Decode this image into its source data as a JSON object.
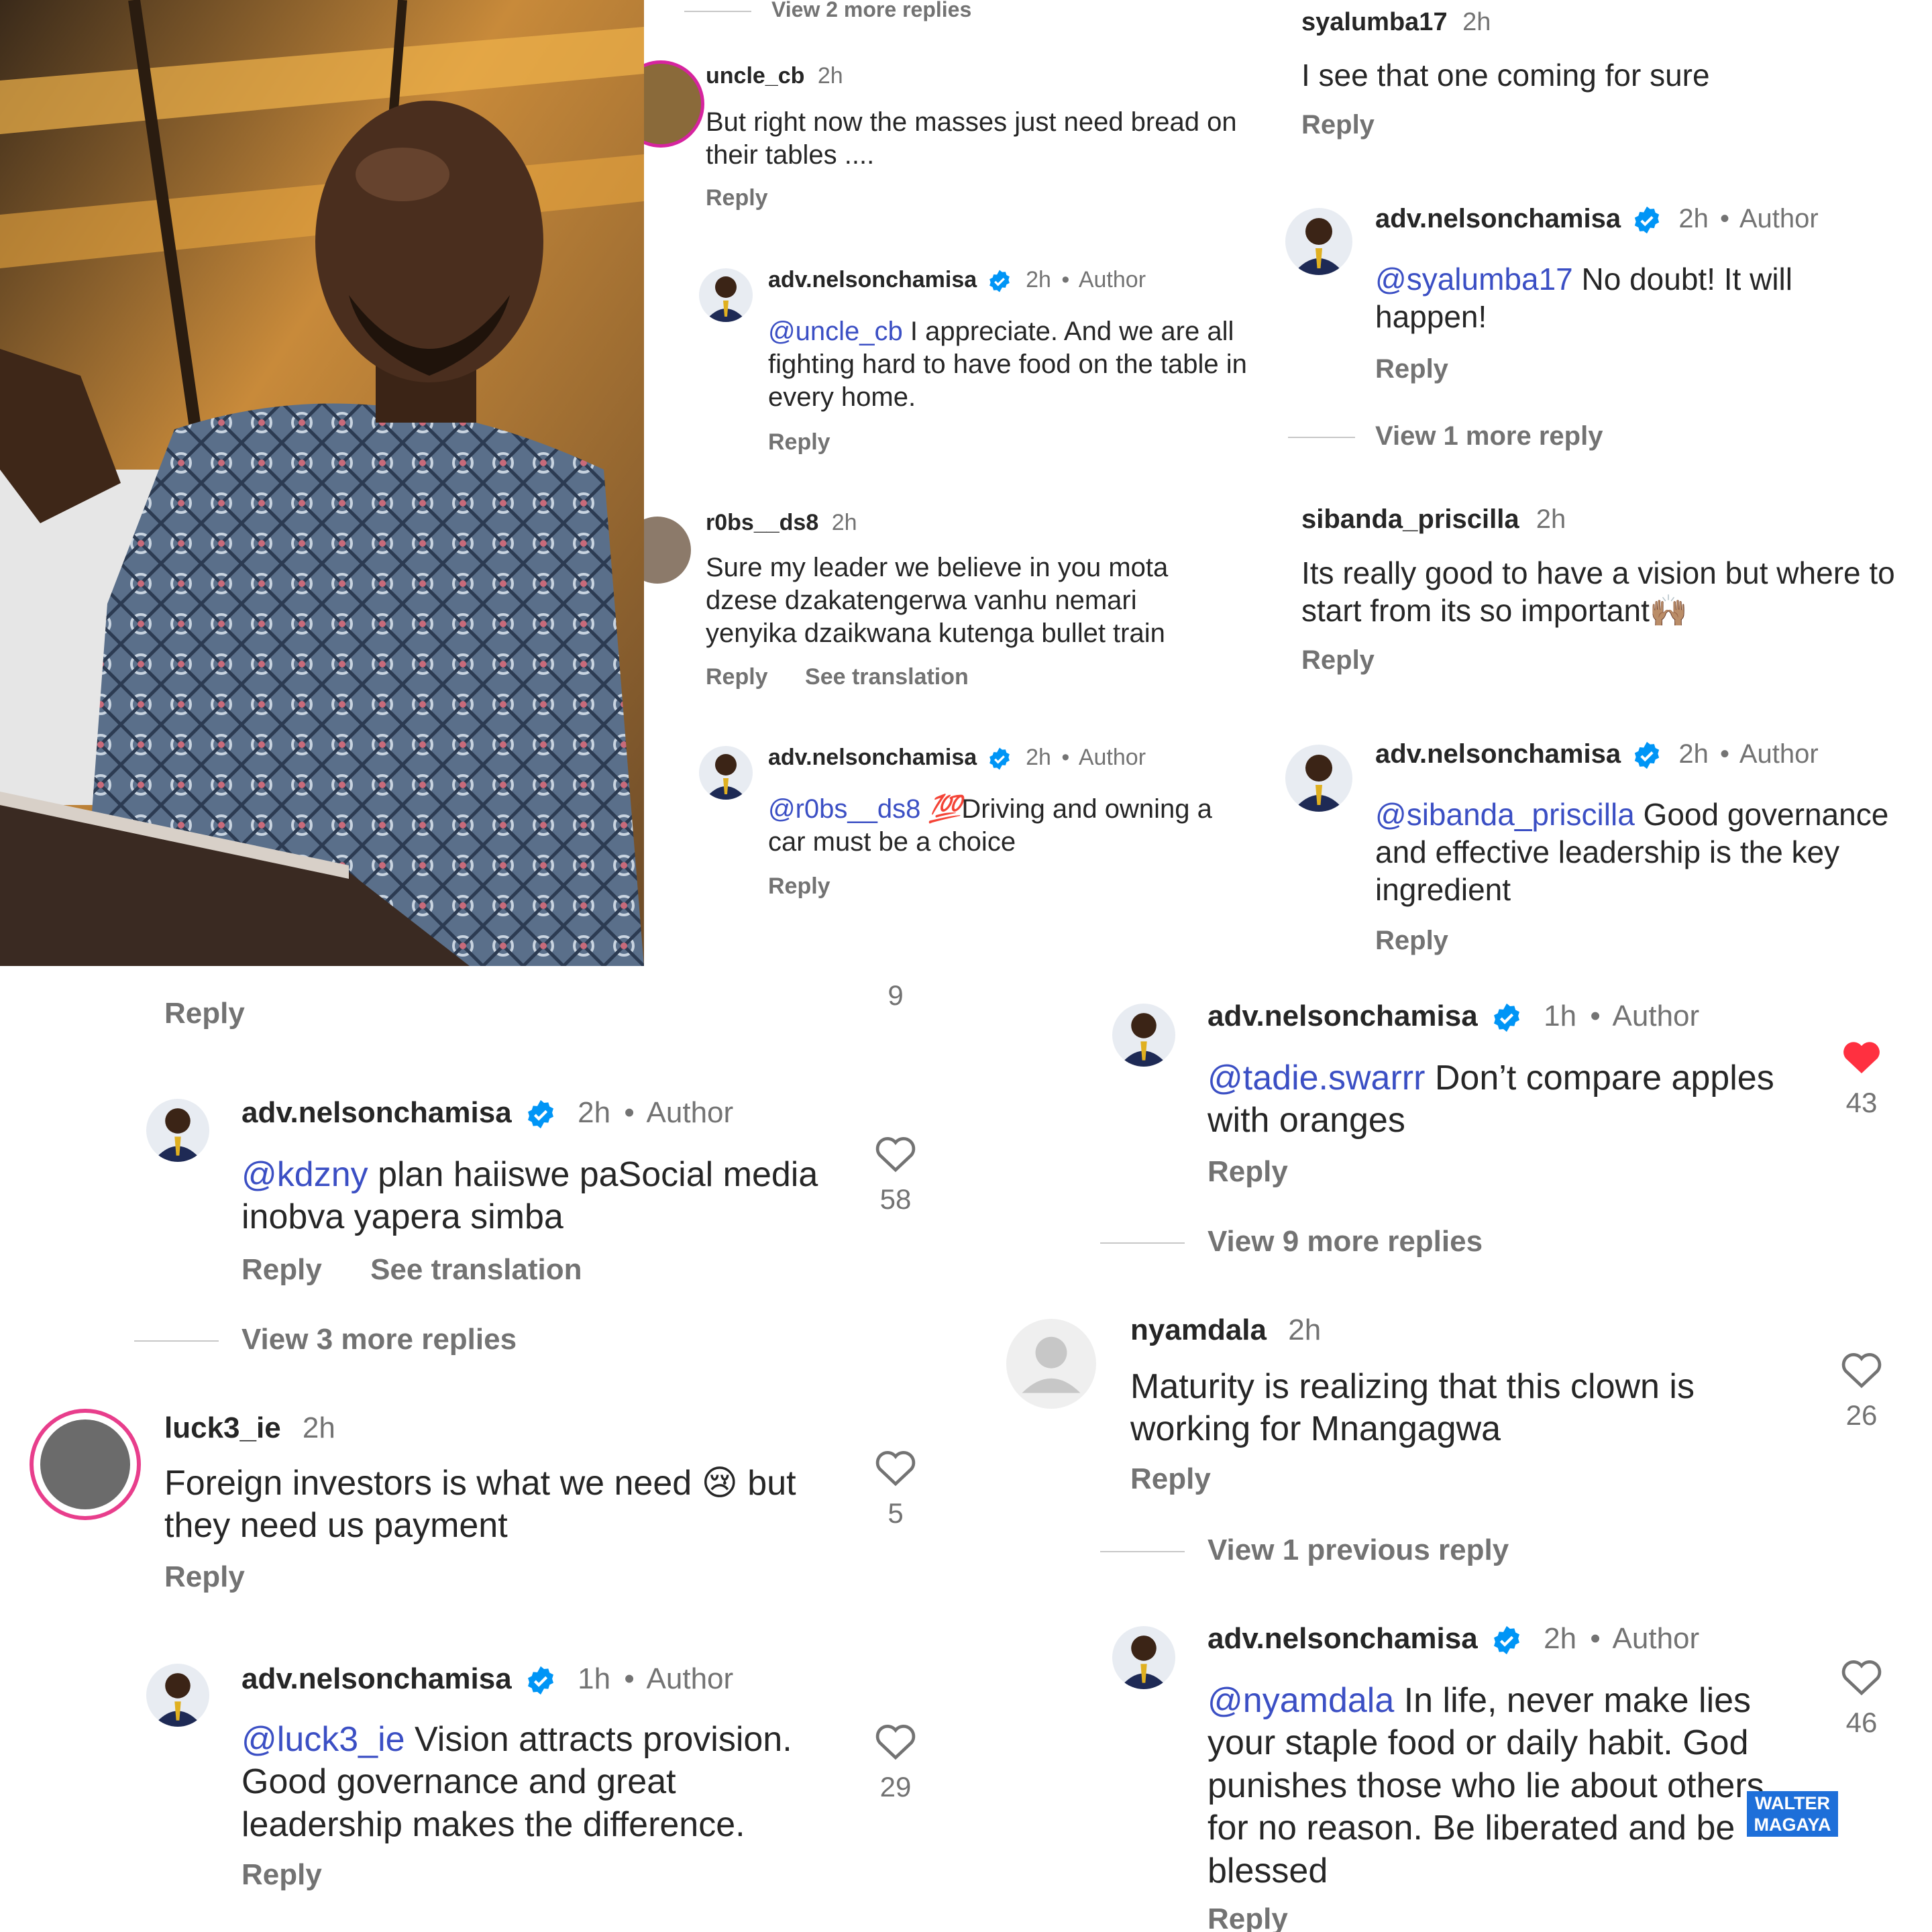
{
  "photo": {
    "alt": "speaker at podium"
  },
  "common": {
    "reply": "Reply",
    "see_translation": "See translation",
    "author_tag": "Author",
    "dot": "•"
  },
  "p1": {
    "top_view": "View 2 more replies",
    "c1": {
      "user": "uncle_cb",
      "time": "2h",
      "text": "But right now the masses just need bread on their tables ...."
    },
    "c2": {
      "user": "adv.nelsonchamisa",
      "time": "2h",
      "mention": "@uncle_cb",
      "text": " I appreciate. And we are all fighting hard to have food on the table in every home."
    },
    "c3": {
      "user": "r0bs__ds8",
      "time": "2h",
      "text": "Sure my leader we believe in you mota dzese dzakatengerwa vanhu nemari yenyika dzaikwana kutenga bullet train"
    },
    "c4": {
      "user": "adv.nelsonchamisa",
      "time": "2h",
      "mention": "@r0bs__ds8",
      "emoji": "💯",
      "text": "Driving and owning a car must be a choice"
    }
  },
  "p2": {
    "c1": {
      "user": "syalumba17",
      "time": "2h",
      "text": "I see that one coming for sure"
    },
    "c2": {
      "user": "adv.nelsonchamisa",
      "time": "2h",
      "mention": "@syalumba17",
      "text": " No doubt! It will happen!"
    },
    "view1": "View 1 more reply",
    "c3": {
      "user": "sibanda_priscilla",
      "time": "2h",
      "text": "Its really good to have a vision but where to start from its so important",
      "emoji": "🙌🏽"
    },
    "c4": {
      "user": "adv.nelsonchamisa",
      "time": "2h",
      "mention": "@sibanda_priscilla",
      "text": " Good governance and effective leadership is the key ingredient"
    }
  },
  "p3": {
    "top_likes": "9",
    "c1": {
      "user": "adv.nelsonchamisa",
      "time": "2h",
      "mention": "@kdzny",
      "text": " plan haiiswe paSocial media inobva yapera simba",
      "likes": "58"
    },
    "view3": "View 3 more replies",
    "c2": {
      "user": "luck3_ie",
      "time": "2h",
      "text_a": "Foreign investors is what we need ",
      "emoji": "😢",
      "text_b": " but they need us payment",
      "likes": "5"
    },
    "c3": {
      "user": "adv.nelsonchamisa",
      "time": "1h",
      "mention": "@luck3_ie",
      "text": " Vision attracts provision. Good governance and great leadership makes the difference.",
      "likes": "29"
    }
  },
  "p4": {
    "c1": {
      "user": "adv.nelsonchamisa",
      "time": "1h",
      "mention": "@tadie.swarrr",
      "text": " Don’t compare apples with oranges",
      "likes": "43"
    },
    "view9": "View 9 more replies",
    "c2": {
      "user": "nyamdala",
      "time": "2h",
      "text": "Maturity is realizing that this clown is working for Mnangagwa",
      "likes": "26"
    },
    "view_prev": "View 1 previous reply",
    "c3": {
      "user": "adv.nelsonchamisa",
      "time": "2h",
      "mention": "@nyamdala",
      "text": " In life, never make lies your staple food or daily habit. God punishes those who lie about others for no reason. Be liberated and be blessed",
      "likes": "46"
    }
  },
  "watermark": {
    "line1": "WALTER",
    "line2": "MAGAYA"
  },
  "colors": {
    "verified": "#0095f6",
    "liked": "#ff3040",
    "mention": "#3b4fc4",
    "muted": "#737373"
  }
}
